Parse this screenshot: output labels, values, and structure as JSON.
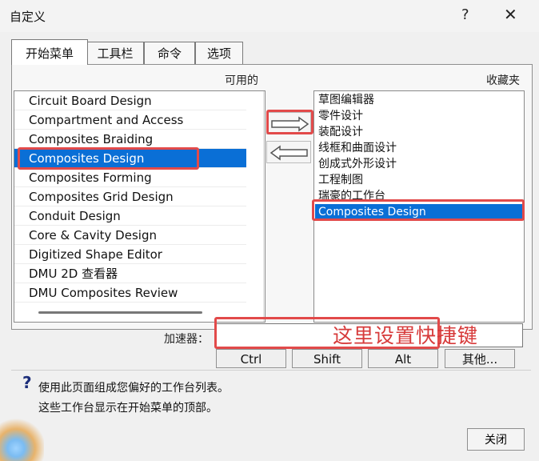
{
  "window": {
    "title": "自定义",
    "help_label": "?",
    "close_label": "✕"
  },
  "tabs": [
    {
      "label": "开始菜单"
    },
    {
      "label": "工具栏"
    },
    {
      "label": "命令"
    },
    {
      "label": "选项"
    }
  ],
  "sections": {
    "available": "可用的",
    "favorites": "收藏夹"
  },
  "available_items": [
    "Circuit Board Design",
    "Compartment and Access",
    "Composites Braiding",
    "Composites Design",
    "Composites Forming",
    "Composites Grid Design",
    "Conduit Design",
    "Core & Cavity Design",
    "Digitized Shape Editor",
    "DMU 2D 查看器",
    "DMU Composites Review"
  ],
  "favorite_items": [
    "草图编辑器",
    "零件设计",
    "装配设计",
    "线框和曲面设计",
    "创成式外形设计",
    "工程制图",
    "瑞豪的工作台",
    "Composites Design"
  ],
  "accelerator": {
    "label": "加速器：",
    "value": "",
    "overlay_text": "这里设置快捷键"
  },
  "modifier_buttons": [
    "Ctrl",
    "Shift",
    "Alt",
    "其他..."
  ],
  "help_text": {
    "line1": "使用此页面组成您偏好的工作台列表。",
    "line2": "这些工作台显示在开始菜单的顶部。"
  },
  "footer": {
    "close_label": "关闭"
  },
  "selected": {
    "available_index": 3,
    "favorite_index": 7
  },
  "colors": {
    "selection": "#0a6fd6",
    "highlight": "#e24a4a"
  }
}
